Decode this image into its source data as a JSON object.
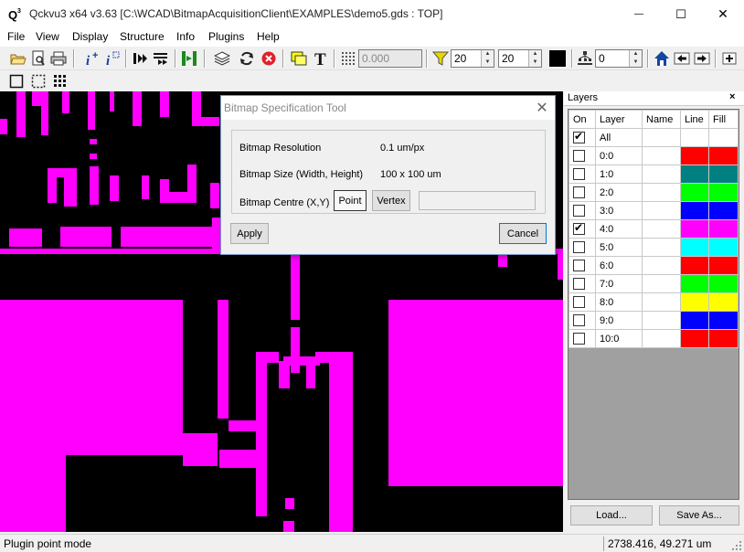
{
  "window": {
    "title": "Qckvu3 x64 v3.63 [C:\\WCAD\\BitmapAcquisitionClient\\EXAMPLES\\demo5.gds : TOP]",
    "minimize": "—",
    "maximize": "☐",
    "close": "✕"
  },
  "menu": {
    "items": [
      "File",
      "View",
      "Display",
      "Structure",
      "Info",
      "Plugins",
      "Help"
    ]
  },
  "toolbar": {
    "snap_value": "0.000",
    "filter_min": "20",
    "filter_max": "20",
    "depth_value": "0",
    "icons": [
      "open-folder-icon",
      "print-preview-icon",
      "print-icon",
      "info-cursor-icon",
      "info-query-icon",
      "play-forward-icon",
      "play-list-icon",
      "go-to-end-icon",
      "layers-icon",
      "refresh-icon",
      "stop-icon",
      "highlight-icon",
      "text-icon",
      "grid-icon",
      "filter-icon",
      "black-square-icon",
      "hierarchy-icon",
      "home-icon",
      "back-icon",
      "forward-icon",
      "plus-icon"
    ]
  },
  "dialog": {
    "title": "Bitmap Specification Tool",
    "close": "✕",
    "resolution_label": "Bitmap Resolution",
    "resolution_value": "0.1 um/px",
    "size_label": "Bitmap Size (Width, Height)",
    "size_value": "100 x 100 um",
    "centre_label": "Bitmap Centre (X,Y)",
    "point_button": "Point",
    "vertex_button": "Vertex",
    "centre_value": "",
    "apply_button": "Apply",
    "cancel_button": "Cancel"
  },
  "layers": {
    "title": "Layers",
    "close": "×",
    "columns": [
      "On",
      "Layer",
      "Name",
      "Line",
      "Fill"
    ],
    "rows": [
      {
        "on": true,
        "layer": "All",
        "name": "",
        "color": ""
      },
      {
        "on": false,
        "layer": "0:0",
        "name": "",
        "color": "#ff0000"
      },
      {
        "on": false,
        "layer": "1:0",
        "name": "",
        "color": "#008080"
      },
      {
        "on": false,
        "layer": "2:0",
        "name": "",
        "color": "#00ff00"
      },
      {
        "on": false,
        "layer": "3:0",
        "name": "",
        "color": "#0000ff"
      },
      {
        "on": true,
        "layer": "4:0",
        "name": "",
        "color": "#ff00ff"
      },
      {
        "on": false,
        "layer": "5:0",
        "name": "",
        "color": "#00ffff"
      },
      {
        "on": false,
        "layer": "6:0",
        "name": "",
        "color": "#ff0000"
      },
      {
        "on": false,
        "layer": "7:0",
        "name": "",
        "color": "#00ff00"
      },
      {
        "on": false,
        "layer": "8:0",
        "name": "",
        "color": "#ffff00"
      },
      {
        "on": false,
        "layer": "9:0",
        "name": "",
        "color": "#0000ff"
      },
      {
        "on": false,
        "layer": "10:0",
        "name": "",
        "color": "#ff0000"
      }
    ],
    "load_button": "Load...",
    "saveas_button": "Save As..."
  },
  "status": {
    "mode": "Plugin point mode",
    "coords": "2738.416, 49.271 um"
  },
  "colors": {
    "layout_fill": "#ff00ff",
    "canvas_bg": "#000000"
  }
}
